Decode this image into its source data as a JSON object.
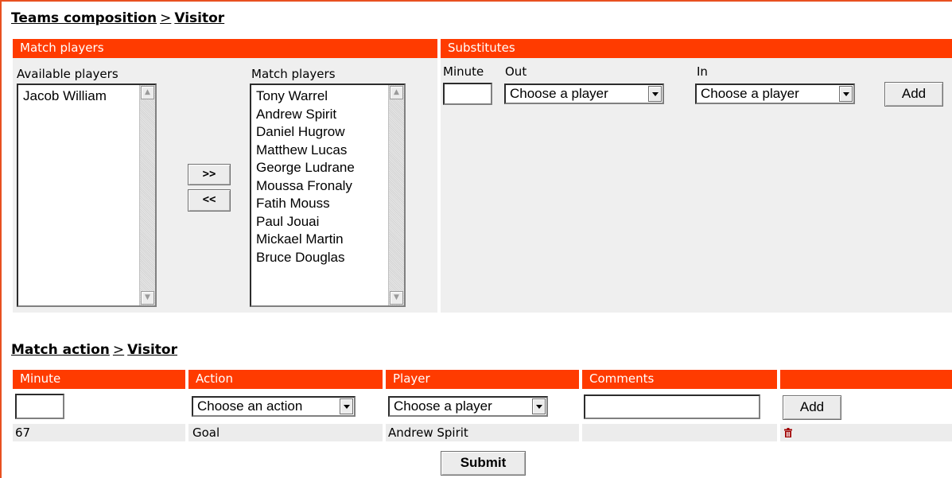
{
  "teams_section": {
    "title_main": "Teams composition",
    "title_sep": ">",
    "title_team": "Visitor"
  },
  "match_players_panel": {
    "header": "Match players",
    "available_label": "Available players",
    "available_players": [
      "Jacob William"
    ],
    "match_label": "Match players",
    "match_players": [
      "Tony Warrel",
      "Andrew Spirit",
      "Daniel Hugrow",
      "Matthew Lucas",
      "George Ludrane",
      "Moussa Fronaly",
      "Fatih Mouss",
      "Paul Jouai",
      "Mickael Martin",
      "Bruce Douglas"
    ],
    "move_right_label": ">>",
    "move_left_label": "<<"
  },
  "substitutes_panel": {
    "header": "Substitutes",
    "minute_label": "Minute",
    "minute_value": "",
    "out_label": "Out",
    "out_selected": "Choose a player",
    "in_label": "In",
    "in_selected": "Choose a player",
    "add_label": "Add"
  },
  "actions_section": {
    "title_main": "Match action",
    "title_sep": ">",
    "title_team": "Visitor",
    "columns": [
      "Minute",
      "Action",
      "Player",
      "Comments",
      ""
    ],
    "new_minute_value": "",
    "action_selected": "Choose an action",
    "player_selected": "Choose a player",
    "comments_value": "",
    "add_label": "Add",
    "rows": [
      {
        "minute": "67",
        "action": "Goal",
        "player": "Andrew Spirit",
        "comments": ""
      }
    ],
    "delete_icon": "trash-icon",
    "delete_color": "#a00000"
  },
  "submit_label": "Submit",
  "colors": {
    "accent": "#ff3b00",
    "panel": "#efefef",
    "frame": "#e85020"
  }
}
